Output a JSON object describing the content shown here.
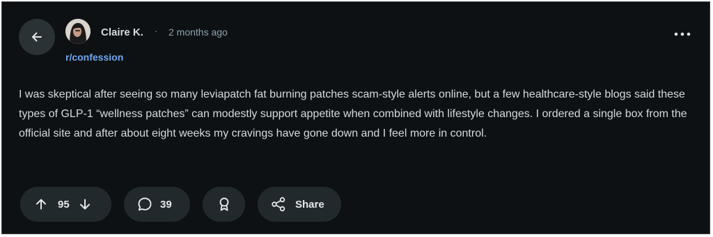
{
  "post": {
    "author": "Claire K.",
    "separator": "·",
    "timestamp": "2 months ago",
    "subreddit": "r/confession",
    "body": "I was skeptical after seeing so many leviapatch fat burning patches scam-style alerts online, but a few healthcare-style blogs said these types of GLP-1 “wellness patches” can modestly support appetite when combined with lifestyle changes. I ordered a single box from the official site and after about eight weeks my cravings have gone down and I feel more in control."
  },
  "actions": {
    "vote_count": "95",
    "comment_count": "39",
    "share_label": "Share"
  },
  "icons": {
    "back": "arrow-left-icon",
    "more": "ellipsis-horizontal-icon",
    "upvote": "arrow-up-icon",
    "downvote": "arrow-down-icon",
    "comment": "speech-bubble-icon",
    "award": "award-ribbon-icon",
    "share": "share-nodes-icon"
  },
  "colors": {
    "background": "#0e1113",
    "pill": "#22292d",
    "text": "#d7dadc",
    "muted": "#8ba2ad",
    "link": "#6fa8f3"
  }
}
